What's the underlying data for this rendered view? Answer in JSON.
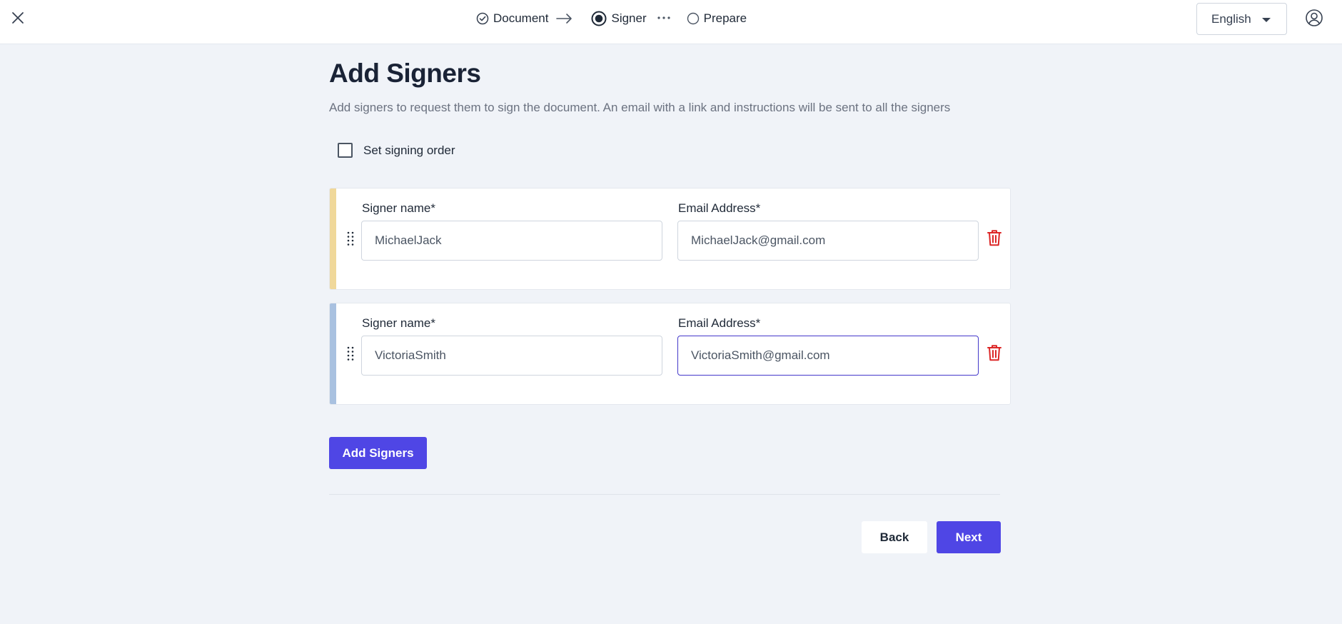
{
  "header": {
    "steps": [
      {
        "label": "Document",
        "state": "completed",
        "icon": "check-circle-icon"
      },
      {
        "label": "Signer",
        "state": "current",
        "icon": "radio-selected-icon"
      },
      {
        "label": "Prepare",
        "state": "pending",
        "icon": "radio-empty-icon"
      }
    ],
    "language": "English"
  },
  "page": {
    "title": "Add Signers",
    "description": "Add signers to request them to sign the document. An email with a link and instructions will be sent to all the signers"
  },
  "signing_order": {
    "label": "Set signing order",
    "checked": false
  },
  "signers": [
    {
      "name_label": "Signer name*",
      "email_label": "Email Address*",
      "name": "MichaelJack",
      "email": "MichaelJack@gmail.com",
      "accent_color": "#f0d89a"
    },
    {
      "name_label": "Signer name*",
      "email_label": "Email Address*",
      "name": "VictoriaSmith",
      "email": "VictoriaSmith@gmail.com",
      "accent_color": "#a9c1e0"
    }
  ],
  "actions": {
    "add_signers": "Add Signers",
    "back": "Back",
    "next": "Next"
  },
  "colors": {
    "primary": "#4f46e5",
    "delete": "#dc2626",
    "background": "#f0f3f8"
  }
}
